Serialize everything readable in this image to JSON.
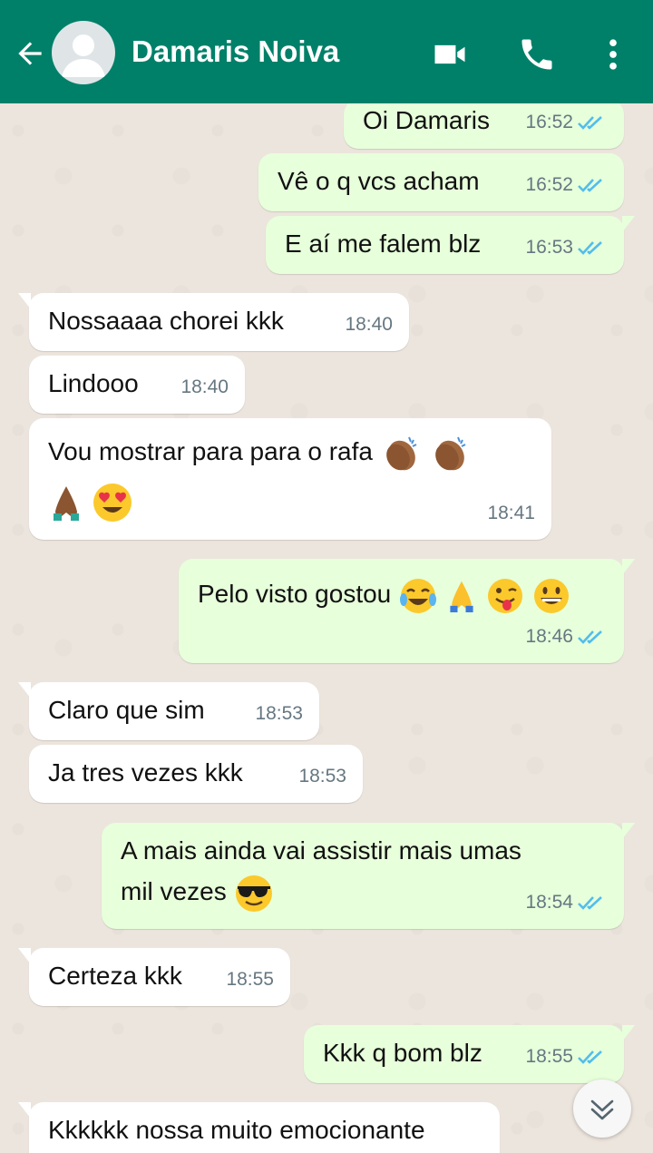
{
  "header": {
    "contact_name": "Damaris Noiva",
    "color": "#008069"
  },
  "messages": [
    {
      "dir": "out",
      "text": "Oi Damaris",
      "time": "16:52",
      "status": "read"
    },
    {
      "dir": "out",
      "text": "Vê o q vcs acham",
      "time": "16:52",
      "status": "read"
    },
    {
      "dir": "out",
      "text": "E aí me falem blz",
      "time": "16:53",
      "status": "read"
    },
    {
      "dir": "in",
      "text": "Nossaaaa chorei kkk",
      "time": "18:40"
    },
    {
      "dir": "in",
      "text": "Lindooo",
      "time": "18:40"
    },
    {
      "dir": "in",
      "text": "Vou mostrar para para o rafa",
      "emoji_line1": [
        "clapping-hands",
        "clapping-hands"
      ],
      "emoji_line2": [
        "folded-hands",
        "heart-eyes"
      ],
      "time": "18:41"
    },
    {
      "dir": "out",
      "text": "Pelo visto gostou",
      "emoji": [
        "tears-of-joy",
        "folded-hands",
        "winking-tongue",
        "grinning"
      ],
      "time": "18:46",
      "status": "read"
    },
    {
      "dir": "in",
      "text": "Claro que sim",
      "time": "18:53"
    },
    {
      "dir": "in",
      "text": "Ja tres vezes kkk",
      "time": "18:53"
    },
    {
      "dir": "out",
      "text": "A mais ainda vai assistir mais umas",
      "text2": "mil vezes",
      "emoji": [
        "sunglasses"
      ],
      "time": "18:54",
      "status": "read"
    },
    {
      "dir": "in",
      "text": "Certeza kkk",
      "time": "18:55"
    },
    {
      "dir": "out",
      "text": "Kkk q bom blz",
      "time": "18:55",
      "status": "read"
    },
    {
      "dir": "in",
      "text": "Kkkkkk nossa muito emocionante",
      "time": ""
    }
  ],
  "colors": {
    "incoming": "#ffffff",
    "outgoing": "#e7ffdb",
    "read_ticks": "#53bdeb",
    "background": "#ece5dd"
  }
}
